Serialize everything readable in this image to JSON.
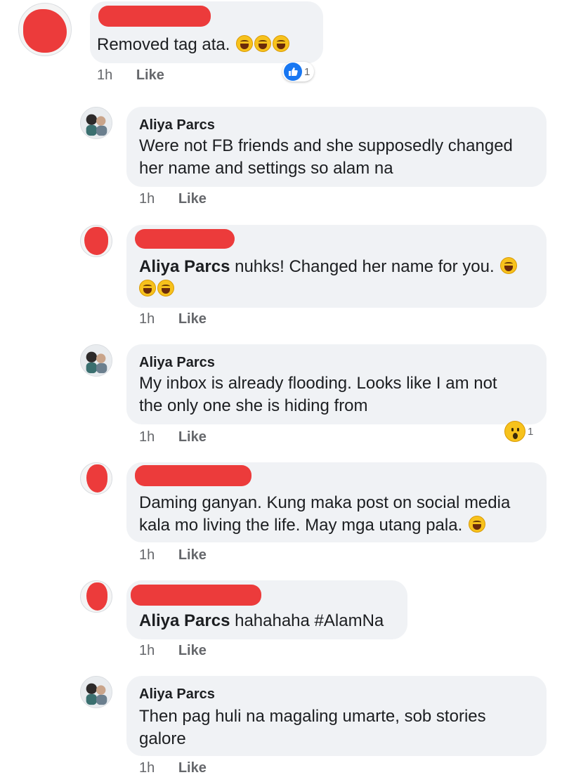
{
  "comments": [
    {
      "author": "",
      "text_main": "Removed tag ata.",
      "time": "1h",
      "like_label": "Like",
      "reaction": {
        "type": "like",
        "count": "1"
      }
    },
    {
      "author": "Aliya Parcs",
      "text_lines": [
        "Were not FB friends and she supposedly changed",
        "her name and settings so alam na"
      ],
      "time": "1h",
      "like_label": "Like"
    },
    {
      "author": "",
      "mention": "Aliya Parcs",
      "text_main": "nuhks! Changed her name for you.",
      "time": "1h",
      "like_label": "Like"
    },
    {
      "author": "Aliya Parcs",
      "text_lines": [
        "My inbox is already flooding. Looks like I am not",
        "the only one she is hiding from"
      ],
      "time": "1h",
      "like_label": "Like",
      "reaction": {
        "type": "wow",
        "count": "1"
      }
    },
    {
      "author": "",
      "text_lines": [
        "Daming ganyan. Kung maka post on social media",
        "kala mo living the life. May mga utang pala."
      ],
      "time": "1h",
      "like_label": "Like"
    },
    {
      "author": "",
      "mention": "Aliya Parcs",
      "text_main": "hahahaha #AlamNa",
      "time": "1h",
      "like_label": "Like"
    },
    {
      "author": "Aliya Parcs",
      "text_lines": [
        "Then pag huli na magaling umarte, sob stories",
        "galore"
      ],
      "time": "1h",
      "like_label": "Like"
    }
  ],
  "colors": {
    "bubble": "#f0f2f5",
    "redaction": "#ec3b3b",
    "like_blue": "#1877f2",
    "meta_gray": "#65676b"
  },
  "icons": [
    "like-icon",
    "wow-icon",
    "laughing-emoji-icon"
  ]
}
